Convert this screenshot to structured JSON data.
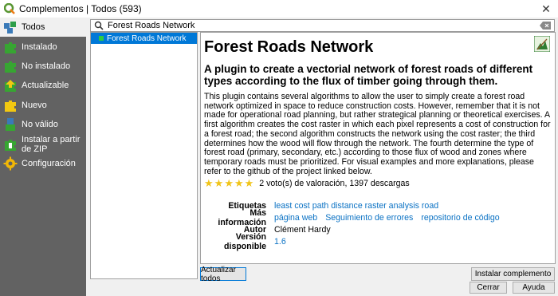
{
  "window": {
    "title": "Complementos | Todos (593)",
    "close_glyph": "✕"
  },
  "sidebar": {
    "items": [
      {
        "label": "Todos",
        "icon": "all-plugins-icon",
        "active": true
      },
      {
        "label": "Instalado",
        "icon": "installed-plugin-icon"
      },
      {
        "label": "No instalado",
        "icon": "not-installed-plugin-icon"
      },
      {
        "label": "Actualizable",
        "icon": "upgradeable-plugin-icon"
      },
      {
        "label": "Nuevo",
        "icon": "new-plugin-icon"
      },
      {
        "label": "No válido",
        "icon": "invalid-plugin-icon"
      },
      {
        "label": "Instalar a partir de ZIP",
        "icon": "install-zip-icon"
      },
      {
        "label": "Configuración",
        "icon": "settings-gear-icon"
      }
    ]
  },
  "search": {
    "value": "Forest Roads Network"
  },
  "plugin_list": {
    "items": [
      {
        "label": "Forest Roads Network",
        "selected": true
      }
    ]
  },
  "details": {
    "title": "Forest Roads Network",
    "summary": "A plugin to create a vectorial network of forest roads of different types according to the flux of timber going through them.",
    "description": "This plugin contains several algorithms to allow the user to simply create a forest road network optimized in space to reduce construction costs. However, remember that it is not made for operational road planning, but rather strategical planning or theoretical exercises. A first algorithm creates the cost raster in which each pixel represents a cost of construction for a forest road; the second algorithm constructs the network using the cost raster; the third determines how the wood will flow through the network. The fourth determine the type of forest road (primary, secondary, etc.) according to those flux of wood and zones where temporary roads must be prioritized. For visual examples and more explanations, please refer to the github of the project linked below.",
    "rating": {
      "stars": 5,
      "text": "2 voto(s) de valoración, 1397 descargas"
    },
    "meta": {
      "tags_label": "Etiquetas",
      "tags_value": "least cost path distance raster analysis road",
      "more_info_label": "Más información",
      "links": [
        "página web",
        "Seguimiento de errores",
        "repositorio de código"
      ],
      "author_label": "Autor",
      "author_value": "Clément Hardy",
      "version_label": "Versión disponible",
      "version_value": "1.6"
    }
  },
  "buttons": {
    "update_all": "Actualizar todos",
    "install": "Instalar complemento",
    "close": "Cerrar",
    "help": "Ayuda"
  },
  "colors": {
    "sidebar_bg": "#626262",
    "selection": "#0078d7",
    "link": "#0b72c4",
    "star": "#f0c419"
  }
}
